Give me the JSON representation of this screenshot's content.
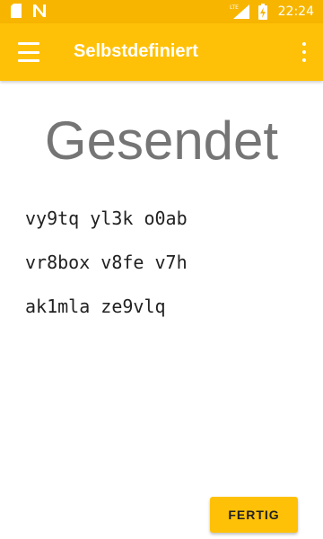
{
  "status_bar": {
    "time": "22:24",
    "icons": [
      "sd-card-icon",
      "notification-n-icon",
      "lte-signal-icon",
      "battery-charging-icon"
    ],
    "network_label": "LTE"
  },
  "app_bar": {
    "title": "Selbstdefiniert",
    "menu_icon": "hamburger-menu-icon",
    "overflow_icon": "overflow-menu-icon",
    "color": "#ffc107"
  },
  "main": {
    "heading": "Gesendet",
    "code_lines": [
      "vy9tq yl3k o0ab",
      "vr8box v8fe v7h",
      "ak1mla ze9vlq"
    ]
  },
  "actions": {
    "done_label": "FERTIG"
  }
}
